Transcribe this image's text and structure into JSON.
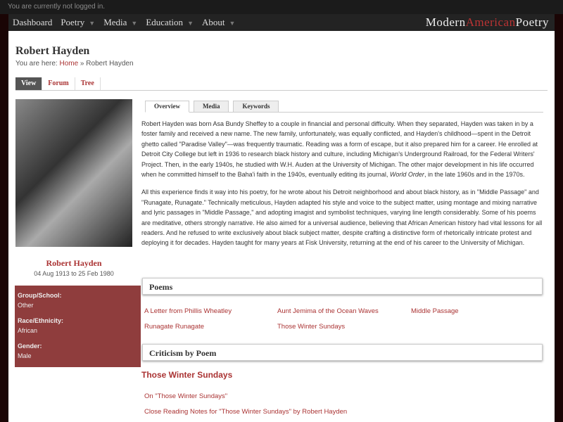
{
  "topbar": {
    "status": "You are currently not logged in."
  },
  "nav": {
    "items": [
      {
        "label": "Dashboard"
      },
      {
        "label": "Poetry"
      },
      {
        "label": "Media"
      },
      {
        "label": "Education"
      },
      {
        "label": "About"
      }
    ],
    "logo": {
      "part1": "Modern",
      "part2": "American",
      "part3": "Poetry"
    }
  },
  "page": {
    "title": "Robert Hayden",
    "breadcrumb": {
      "prefix": "You are here: ",
      "home": "Home",
      "sep": " » ",
      "current": "Robert Hayden"
    },
    "tabs": [
      "View",
      "Forum",
      "Tree"
    ]
  },
  "profile": {
    "name": "Robert Hayden",
    "dates": "04 Aug 1913 to 25 Feb 1980",
    "fields": [
      {
        "label": "Group/School:",
        "value": "Other"
      },
      {
        "label": "Race/Ethnicity:",
        "value": "African"
      },
      {
        "label": "Gender:",
        "value": "Male"
      }
    ]
  },
  "content": {
    "tabs": [
      "Overview",
      "Media",
      "Keywords"
    ],
    "p1a": "Robert Hayden was born Asa Bundy Sheffey to a couple in financial and personal difficulty. When they separated, Hayden was taken in by a foster family and received a new name. The new family, unfortunately, was equally conflicted, and Hayden's childhood—spent in the Detroit ghetto called \"Paradise Valley\"—was frequently traumatic. Reading was a form of escape, but it also prepared him for a career. He enrolled at Detroit City College but left in 1936 to research black history and culture, including Michigan's Underground Railroad, for the Federal Writers' Project. Then, in the early 1940s, he studied with W.H. Auden at the University of Michigan. The other major development in his life occurred when he committed himself to the Baha'i faith in the 1940s, eventually editing its journal, ",
    "p1em": "World Order",
    "p1b": ", in the late 1960s and in the 1970s.",
    "p2": "All this experience finds it way into his poetry, for he wrote about his Detroit neighborhood and about black history, as in \"Middle Passage\" and \"Runagate, Runagate.\" Technically meticulous, Hayden adapted his style and voice to the subject matter, using montage and mixing narrative and lyric passages in \"Middle Passage,\" and adopting imagist and symbolist techniques, varying line length considerably. Some of his poems are meditative, others strongly narrative. He also aimed for a universal audience, believing that African American history had vital lessons for all readers. And he refused to write exclusively about black subject matter, despite crafting a distinctive form of rhetorically intricate protest and deploying it for decades. Hayden taught for many years at Fisk University, returning at the end of his career to the University of Michigan.",
    "poems_heading": "Poems",
    "poems": [
      "A Letter from Phillis Wheatley",
      "Aunt Jemima of the Ocean Waves",
      "Middle Passage",
      "Runagate Runagate",
      "Those Winter Sundays"
    ],
    "criticism_heading": "Criticism by Poem",
    "criticism_poem": "Those Winter Sundays",
    "criticism_links": [
      "On \"Those Winter Sundays\"",
      "Close Reading Notes for \"Those Winter Sundays\" by Robert Hayden"
    ]
  }
}
